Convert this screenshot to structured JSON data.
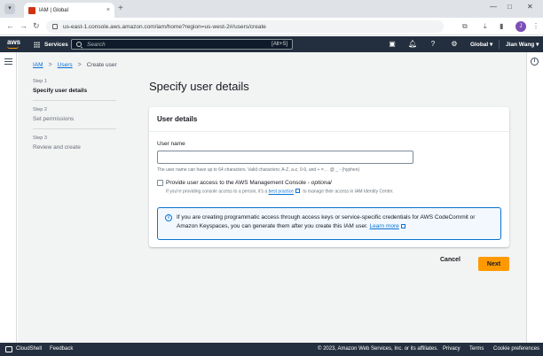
{
  "browser": {
    "tab_title": "IAM | Global",
    "tab_close": "×",
    "new_tab": "+",
    "url": "us-east-1.console.aws.amazon.com/iam/home?region=us-west-2#/users/create",
    "profile_initial": "J",
    "minimize": "—",
    "maximize": "□",
    "close": "✕",
    "back": "←",
    "forward": "→",
    "reload": "↻"
  },
  "aws_nav": {
    "logo": "aws",
    "services": "Services",
    "search_placeholder": "Search",
    "search_shortcut": "[Alt+S]",
    "region": "Global ▾",
    "user": "Jian Wang ▾"
  },
  "breadcrumb": {
    "items": [
      "IAM",
      "Users"
    ],
    "current": "Create user",
    "separator": ">"
  },
  "steps": [
    {
      "num": "Step 1",
      "label": "Specify user details"
    },
    {
      "num": "Step 2",
      "label": "Set permissions"
    },
    {
      "num": "Step 3",
      "label": "Review and create"
    }
  ],
  "page_title": "Specify user details",
  "card": {
    "title": "User details",
    "user_name_label": "User name",
    "user_name_value": "",
    "user_name_hint": "The user name can have up to 64 characters. Valid characters: A-Z, a-z, 0-9, and + = , . @ _ - (hyphen)",
    "console_access_label": "Provide user access to the AWS Management Console - ",
    "console_access_optional": "optional",
    "console_access_desc_before": "If you're providing console access to a person, it's a ",
    "console_access_desc_link": "best practice",
    "console_access_desc_after": " to manage their access in IAM Identity Center.",
    "info_text_before": "If you are creating programmatic access through access keys or service-specific credentials for AWS CodeCommit or Amazon Keyspaces, you can generate them after you create this IAM user. ",
    "info_link": "Learn more"
  },
  "actions": {
    "cancel": "Cancel",
    "next": "Next"
  },
  "footer": {
    "cloudshell": "CloudShell",
    "feedback": "Feedback",
    "copyright": "© 2023, Amazon Web Services, Inc. or its affiliates.",
    "privacy": "Privacy",
    "terms": "Terms",
    "cookies": "Cookie preferences"
  },
  "colors": {
    "aws_nav_bg": "#232f3e",
    "aws_orange": "#ff9900",
    "link_blue": "#0972d3",
    "page_bg": "#f2f3f3"
  }
}
